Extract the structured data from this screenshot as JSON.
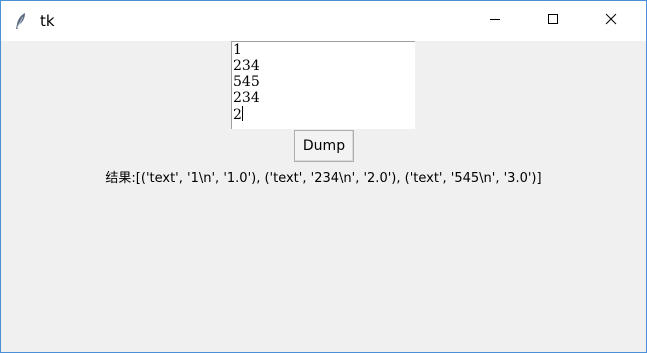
{
  "window": {
    "title": "tk"
  },
  "titlebar_controls": {
    "minimize_icon": "minimize-icon",
    "maximize_icon": "maximize-icon",
    "close_icon": "close-icon"
  },
  "textbox": {
    "lines": [
      "1",
      "234",
      "545",
      "234",
      "2"
    ]
  },
  "dump_button": {
    "label": "Dump"
  },
  "result": {
    "text": "结果:[('text', '1\\n', '1.0'), ('text', '234\\n', '2.0'), ('text', '545\\n', '3.0')]"
  },
  "colors": {
    "window_bg": "#f0f0f0",
    "titlebar_bg": "#ffffff",
    "window_border": "#4a90d9",
    "textbox_bg": "#ffffff"
  }
}
